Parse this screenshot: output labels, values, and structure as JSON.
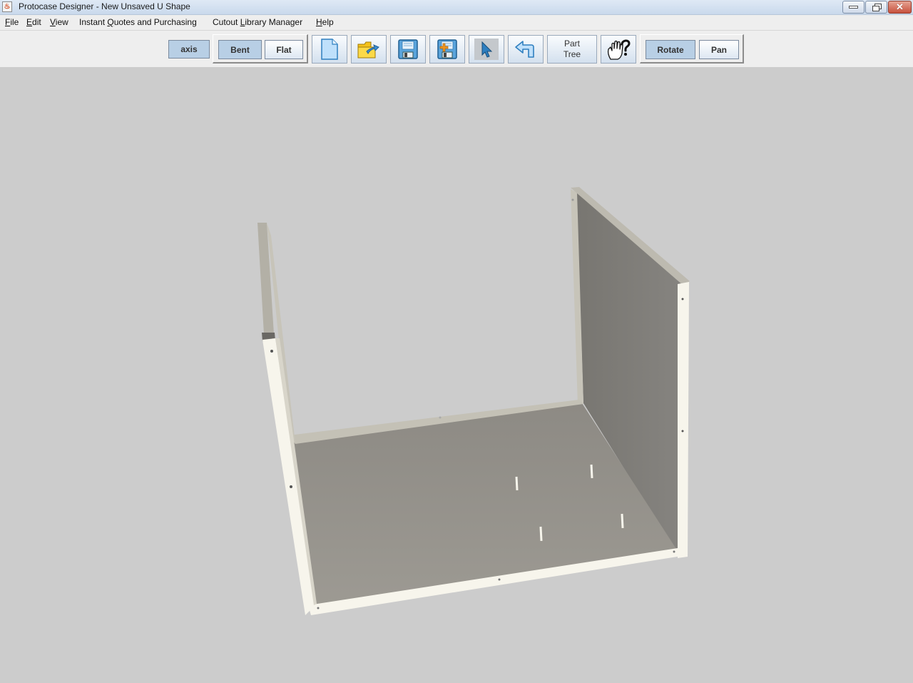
{
  "window": {
    "title": "Protocase Designer - New Unsaved U Shape",
    "app_icon": "java-cup-icon",
    "controls": [
      "minimize",
      "restore",
      "close"
    ]
  },
  "menubar": {
    "items": [
      {
        "label": "File",
        "mnemonic": "F"
      },
      {
        "label": "Edit",
        "mnemonic": "E"
      },
      {
        "label": "View",
        "mnemonic": "V"
      },
      {
        "label": "Instant Quotes and Purchasing",
        "mnemonic": "Q"
      },
      {
        "label": "Cutout Library Manager",
        "mnemonic": "L"
      },
      {
        "label": "Help",
        "mnemonic": "H"
      }
    ]
  },
  "toolbar": {
    "axis_label": "axis",
    "view_mode": {
      "bent_label": "Bent",
      "flat_label": "Flat",
      "selected": "Bent"
    },
    "icons": {
      "new": "new-document-icon",
      "open": "open-folder-icon",
      "save": "save-disk-icon",
      "save_as": "save-as-disk-icon",
      "select": "select-arrow-icon",
      "undo": "undo-arrow-icon",
      "help": "context-help-hand-icon"
    },
    "part_tree_line1": "Part",
    "part_tree_line2": "Tree",
    "nav_mode": {
      "rotate_label": "Rotate",
      "pan_label": "Pan",
      "selected": "Rotate"
    }
  },
  "viewport": {
    "background": "#cccccc",
    "model": {
      "name": "U Shape enclosure",
      "parts": [
        "left-wall",
        "right-wall",
        "base-floor"
      ],
      "slot_count": 4,
      "colors": {
        "floor": "#959189",
        "right_wall": "#817f79",
        "edge_flange": "#f7f5ec",
        "inner_flange": "#c3c0b5"
      }
    }
  }
}
